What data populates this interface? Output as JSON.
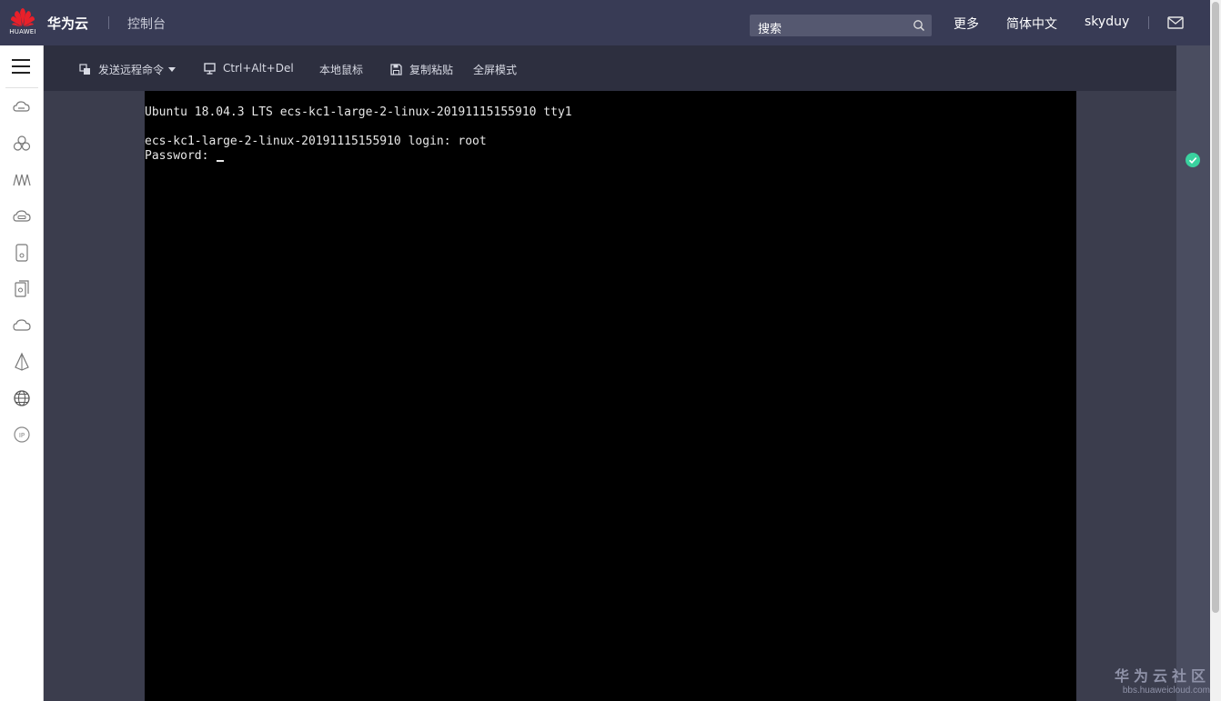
{
  "header": {
    "logo_text": "HUAWEI",
    "brand": "华为云",
    "console": "控制台",
    "search_placeholder": "搜索",
    "more": "更多",
    "language": "简体中文",
    "username": "skyduy"
  },
  "toolbar": {
    "send_remote_command": "发送远程命令",
    "ctrl_alt_del": "Ctrl+Alt+Del",
    "local_mouse": "本地鼠标",
    "copy_paste": "复制粘贴",
    "fullscreen": "全屏模式"
  },
  "sidebar": {
    "icons": [
      "cloud-server-icon",
      "cluster-icon",
      "network-wave-icon",
      "cloud-disk-icon",
      "storage-icon",
      "backup-icon",
      "cloud-icon",
      "image-icon",
      "elastic-ip-globe-icon",
      "ip-icon"
    ]
  },
  "terminal": {
    "lines": [
      "Ubuntu 18.04.3 LTS ecs-kc1-large-2-linux-20191115155910 tty1",
      "",
      "ecs-kc1-large-2-linux-20191115155910 login: root",
      "Password: "
    ]
  },
  "watermark": {
    "main": "华为云社区",
    "sub": "bbs.huaweicloud.com"
  },
  "colors": {
    "header_bg": "#383b55",
    "toolbar_bg": "#2d2f3f",
    "terminal_bg": "#000000",
    "status_ok": "#3ad29f"
  }
}
